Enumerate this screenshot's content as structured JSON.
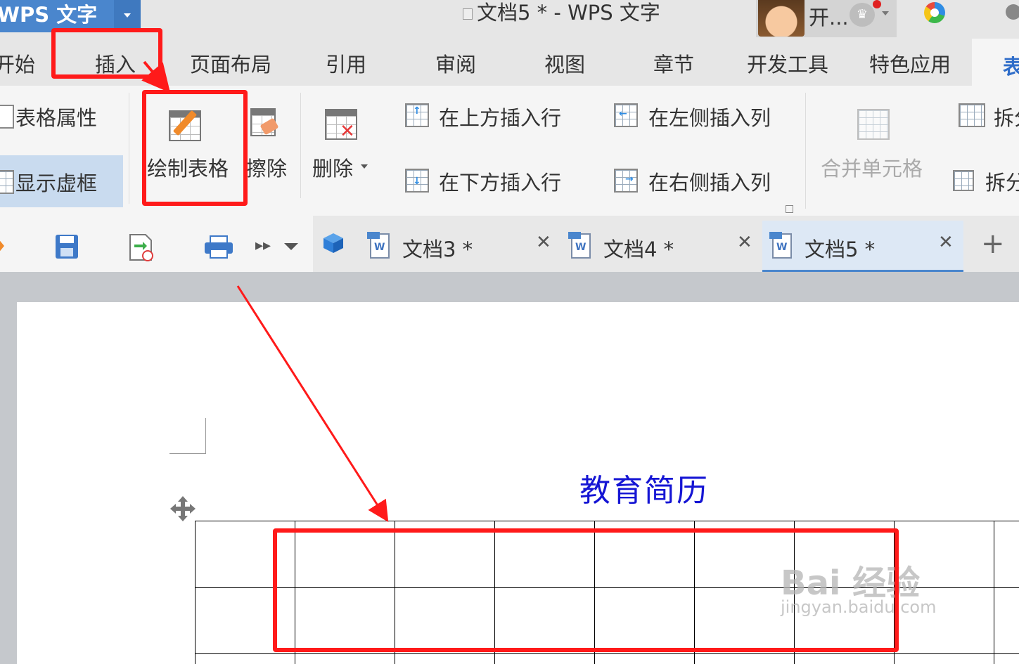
{
  "app": {
    "name": "WPS 文字"
  },
  "window": {
    "title": "文档5 * - WPS 文字"
  },
  "user": {
    "name": "开..."
  },
  "menu": [
    "开始",
    "插入",
    "页面布局",
    "引用",
    "审阅",
    "视图",
    "章节",
    "开发工具",
    "特色应用",
    "表"
  ],
  "ribbon": {
    "table_properties": "表格属性",
    "show_gridlines": "显示虚框",
    "draw_table": "绘制表格",
    "erase": "擦除",
    "delete": "删除",
    "insert_row_above": "在上方插入行",
    "insert_row_below": "在下方插入行",
    "insert_col_left": "在左侧插入列",
    "insert_col_right": "在右侧插入列",
    "merge_cells": "合并单元格",
    "split_1": "拆分",
    "split_2": "拆分"
  },
  "doc_tabs": [
    {
      "name": "文档3 *",
      "active": false
    },
    {
      "name": "文档4 *",
      "active": false
    },
    {
      "name": "文档5 *",
      "active": true
    }
  ],
  "document": {
    "heading": "教育简历"
  },
  "watermark": {
    "brand": "Bai 经验",
    "site": "jingyan.baidu.com"
  },
  "colors": {
    "accent": "#4a86cd",
    "heading": "#1515d4",
    "annotation": "#ff1a1a"
  },
  "icons": [
    "save-icon",
    "export-pdf-icon",
    "print-icon",
    "more-icon",
    "dropdown-icon",
    "cube-icon",
    "new-tab-icon",
    "close-icon",
    "table-move-icon"
  ]
}
